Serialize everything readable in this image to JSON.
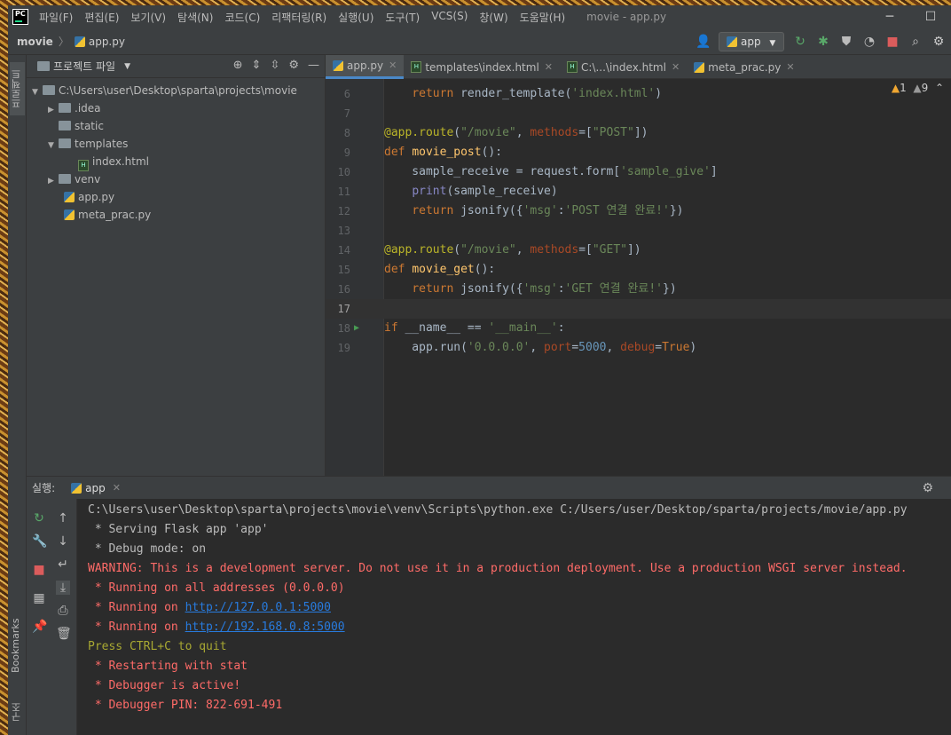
{
  "menu": [
    "파일(F)",
    "편집(E)",
    "보기(V)",
    "탐색(N)",
    "코드(C)",
    "리팩터링(R)",
    "실행(U)",
    "도구(T)",
    "VCS(S)",
    "창(W)",
    "도움말(H)"
  ],
  "window_title": "movie - app.py",
  "breadcrumb": {
    "project": "movie",
    "file": "app.py"
  },
  "run_config": "app",
  "left_stripe": {
    "project": "프로젝트",
    "bookmarks": "Bookmarks",
    "structure": "구조"
  },
  "project_panel": {
    "title": "프로젝트 파일",
    "root": "C:\\Users\\user\\Desktop\\sparta\\projects\\movie",
    "items": [
      ".idea",
      "static",
      "templates",
      "index.html",
      "venv",
      "app.py",
      "meta_prac.py"
    ]
  },
  "tabs": [
    "app.py",
    "templates\\index.html",
    "C:\\...\\index.html",
    "meta_prac.py"
  ],
  "inspections": {
    "warnings": "1",
    "weak": "9"
  },
  "code_lines": [
    {
      "n": "6",
      "t": "    return render_template('index.html')"
    },
    {
      "n": "7",
      "t": ""
    },
    {
      "n": "8",
      "t": "@app.route(\"/movie\", methods=[\"POST\"])"
    },
    {
      "n": "9",
      "t": "def movie_post():"
    },
    {
      "n": "10",
      "t": "    sample_receive = request.form['sample_give']"
    },
    {
      "n": "11",
      "t": "    print(sample_receive)"
    },
    {
      "n": "12",
      "t": "    return jsonify({'msg':'POST 연결 완료!'})"
    },
    {
      "n": "13",
      "t": ""
    },
    {
      "n": "14",
      "t": "@app.route(\"/movie\", methods=[\"GET\"])"
    },
    {
      "n": "15",
      "t": "def movie_get():"
    },
    {
      "n": "16",
      "t": "    return jsonify({'msg':'GET 연결 완료!'})"
    },
    {
      "n": "17",
      "t": ""
    },
    {
      "n": "18",
      "t": "if __name__ == '__main__':"
    },
    {
      "n": "19",
      "t": "    app.run('0.0.0.0', port=5000, debug=True)"
    }
  ],
  "run_panel": {
    "label": "실행:",
    "tab": "app"
  },
  "console": [
    {
      "c": "w",
      "t": "C:\\Users\\user\\Desktop\\sparta\\projects\\movie\\venv\\Scripts\\python.exe C:/Users/user/Desktop/sparta/projects/movie/app.py"
    },
    {
      "c": "w",
      "t": " * Serving Flask app 'app'"
    },
    {
      "c": "w",
      "t": " * Debug mode: on"
    },
    {
      "c": "r",
      "t": "WARNING: This is a development server. Do not use it in a production deployment. Use a production WSGI server instead."
    },
    {
      "c": "r",
      "t": " * Running on all addresses (0.0.0.0)"
    },
    {
      "c": "r",
      "t": " * Running on ",
      "link": "http://127.0.0.1:5000"
    },
    {
      "c": "r",
      "t": " * Running on ",
      "link": "http://192.168.0.8:5000"
    },
    {
      "c": "y",
      "t": "Press CTRL+C to quit"
    },
    {
      "c": "r",
      "t": " * Restarting with stat"
    },
    {
      "c": "r",
      "t": " * Debugger is active!"
    },
    {
      "c": "r",
      "t": " * Debugger PIN: 822-691-491"
    }
  ]
}
